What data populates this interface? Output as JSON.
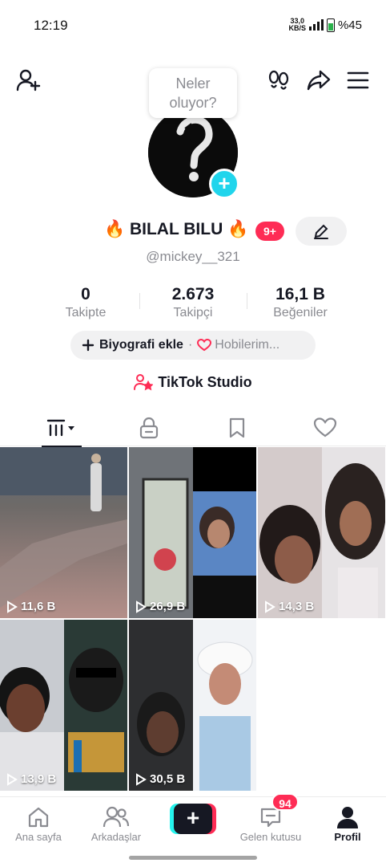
{
  "status_bar": {
    "time": "12:19",
    "net_speed_top": "33,0",
    "net_speed_bottom": "KB/S",
    "battery": "%45"
  },
  "bubble": {
    "line1": "Neler",
    "line2": "oluyor?"
  },
  "profile": {
    "display_name": "🔥 BILAL BILU 🔥",
    "notification_badge": "9+",
    "username": "@mickey__321"
  },
  "stats": [
    {
      "value": "0",
      "label": "Takipte"
    },
    {
      "value": "2.673",
      "label": "Takipçi"
    },
    {
      "value": "16,1 B",
      "label": "Beğeniler"
    }
  ],
  "bio": {
    "add_label": "Biyografi ekle",
    "separator": "·",
    "hobby_label": "Hobilerim..."
  },
  "studio": {
    "label": "TikTok Studio"
  },
  "videos": [
    {
      "views": "11,6 B"
    },
    {
      "views": "26,9 B"
    },
    {
      "views": "14,3 B"
    },
    {
      "views": "13,9 B"
    },
    {
      "views": "30,5 B"
    }
  ],
  "nav": {
    "home": "Ana sayfa",
    "friends": "Arkadaşlar",
    "create": "+",
    "inbox": "Gelen kutusu",
    "inbox_badge": "94",
    "profile": "Profil"
  },
  "colors": {
    "accent": "#fe2c55",
    "cyan": "#25f4ee",
    "plus": "#20d5ec"
  },
  "icons": [
    "add-user-icon",
    "footprint-icon",
    "share-icon",
    "menu-icon",
    "pencil-icon",
    "heart-icon",
    "grid-icon",
    "lock-icon",
    "bookmark-icon",
    "play-icon",
    "home-icon",
    "friends-icon",
    "inbox-icon",
    "profile-icon"
  ]
}
